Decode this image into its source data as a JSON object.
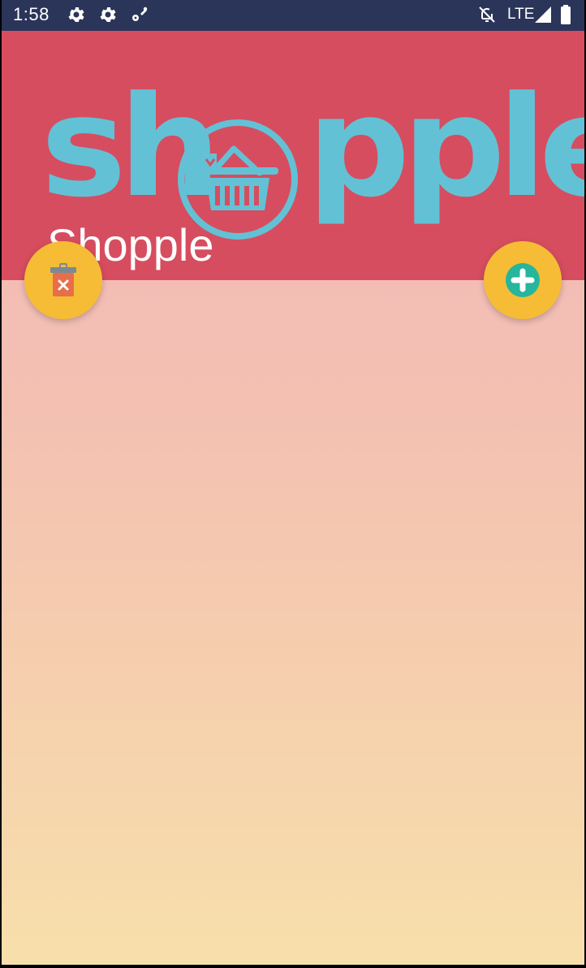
{
  "status_bar": {
    "time": "1:58",
    "network": "LTE",
    "icons": [
      "settings-icon",
      "settings-icon",
      "location-icon",
      "notifications-off-icon",
      "signal-icon",
      "battery-icon"
    ]
  },
  "header": {
    "logo_text_left": "sh",
    "logo_text_right": "pple",
    "title": "Shopple",
    "colors": {
      "header_background": "#d64d5f",
      "logo": "#63c1d6"
    }
  },
  "actions": {
    "delete_icon": "trash-icon",
    "add_icon": "add-circle-icon",
    "fab_color": "#f6bc35"
  },
  "background": {
    "gradient_top": "#f3bdb5",
    "gradient_bottom": "#f7dfab"
  }
}
